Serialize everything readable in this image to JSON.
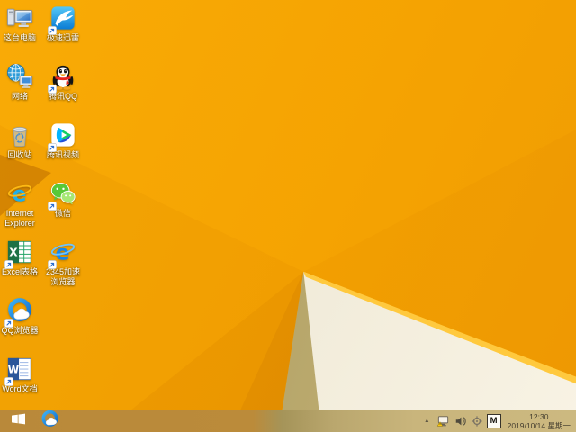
{
  "desktop": {
    "icons": [
      {
        "name": "this-pc",
        "label": "这台电脑",
        "icon": "this-pc-icon",
        "col": 0,
        "row": 0,
        "shortcut_arrow": false
      },
      {
        "name": "xunlei",
        "label": "极速迅雷",
        "icon": "xunlei-icon",
        "col": 1,
        "row": 0,
        "shortcut_arrow": true
      },
      {
        "name": "network",
        "label": "网络",
        "icon": "network-icon",
        "col": 0,
        "row": 1,
        "shortcut_arrow": false
      },
      {
        "name": "tencent-qq",
        "label": "腾讯QQ",
        "icon": "qq-penguin-icon",
        "col": 1,
        "row": 1,
        "shortcut_arrow": true
      },
      {
        "name": "recycle-bin",
        "label": "回收站",
        "icon": "recycle-bin-icon",
        "col": 0,
        "row": 2,
        "shortcut_arrow": false
      },
      {
        "name": "tencent-video",
        "label": "腾讯视频",
        "icon": "tencent-video-icon",
        "col": 1,
        "row": 2,
        "shortcut_arrow": true
      },
      {
        "name": "internet-explorer",
        "label": "Internet Explorer",
        "icon": "ie-icon",
        "col": 0,
        "row": 3,
        "shortcut_arrow": false
      },
      {
        "name": "wechat",
        "label": "微信",
        "icon": "wechat-icon",
        "col": 1,
        "row": 3,
        "shortcut_arrow": true
      },
      {
        "name": "excel",
        "label": "Excel表格",
        "icon": "excel-icon",
        "col": 0,
        "row": 4,
        "shortcut_arrow": true
      },
      {
        "name": "browser-2345",
        "label": "2345加速浏览器",
        "icon": "browser-2345-icon",
        "col": 1,
        "row": 4,
        "shortcut_arrow": true
      },
      {
        "name": "qq-browser",
        "label": "QQ浏览器",
        "icon": "qq-browser-icon",
        "col": 0,
        "row": 5,
        "shortcut_arrow": true
      },
      {
        "name": "word",
        "label": "Word文档",
        "icon": "word-icon",
        "col": 0,
        "row": 6,
        "shortcut_arrow": true
      }
    ]
  },
  "wallpaper": {
    "base_color": "#f5a302",
    "facet_cream": "#f2ecdb",
    "facet_khaki": "#ad9d62",
    "highlight_color": "#ffc93e"
  },
  "taskbar": {
    "start_button_icon": "windows-logo-icon",
    "pinned": [
      {
        "name": "qq-browser",
        "icon": "qq-browser-icon"
      }
    ],
    "tray": {
      "hidden_icons_chevron": "▲",
      "tray_icon_names": [
        "network-status-warning-icon",
        "volume-icon",
        "target-icon",
        "ime-mode-indicator"
      ],
      "ime_label": "M",
      "clock": {
        "time": "12:30",
        "date": "2019/10/14 星期一"
      }
    }
  }
}
